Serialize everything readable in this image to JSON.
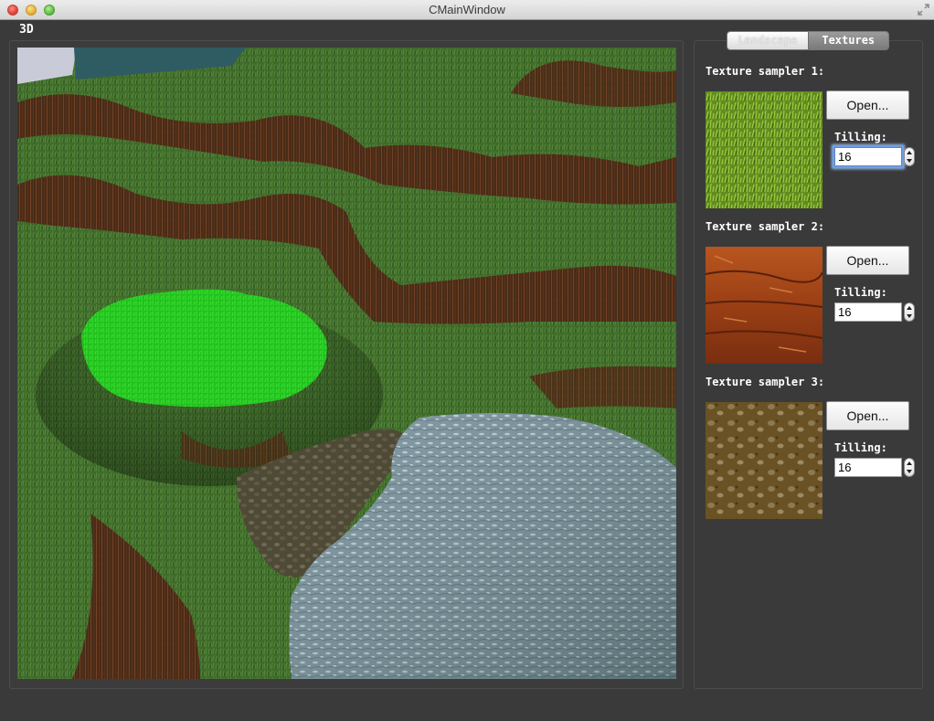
{
  "window": {
    "title": "CMainWindow"
  },
  "view": {
    "label": "3D"
  },
  "tabs": [
    {
      "label": "Landscape",
      "selected": false
    },
    {
      "label": "Textures",
      "selected": true
    }
  ],
  "samplers": [
    {
      "label": "Texture sampler 1:",
      "open_label": "Open...",
      "tilling_label": "Tilling:",
      "tilling_value": "16",
      "texture": "grass"
    },
    {
      "label": "Texture sampler 2:",
      "open_label": "Open...",
      "tilling_label": "Tilling:",
      "tilling_value": "16",
      "texture": "red-rock"
    },
    {
      "label": "Texture sampler 3:",
      "open_label": "Open...",
      "tilling_label": "Tilling:",
      "tilling_value": "16",
      "texture": "dirt-pebbles"
    }
  ],
  "colors": {
    "background": "#3a3a3a",
    "grass": "#3f6b2a",
    "highlight_green": "#22c21c",
    "rock": "#7a2e14",
    "water": "#6c8794"
  }
}
